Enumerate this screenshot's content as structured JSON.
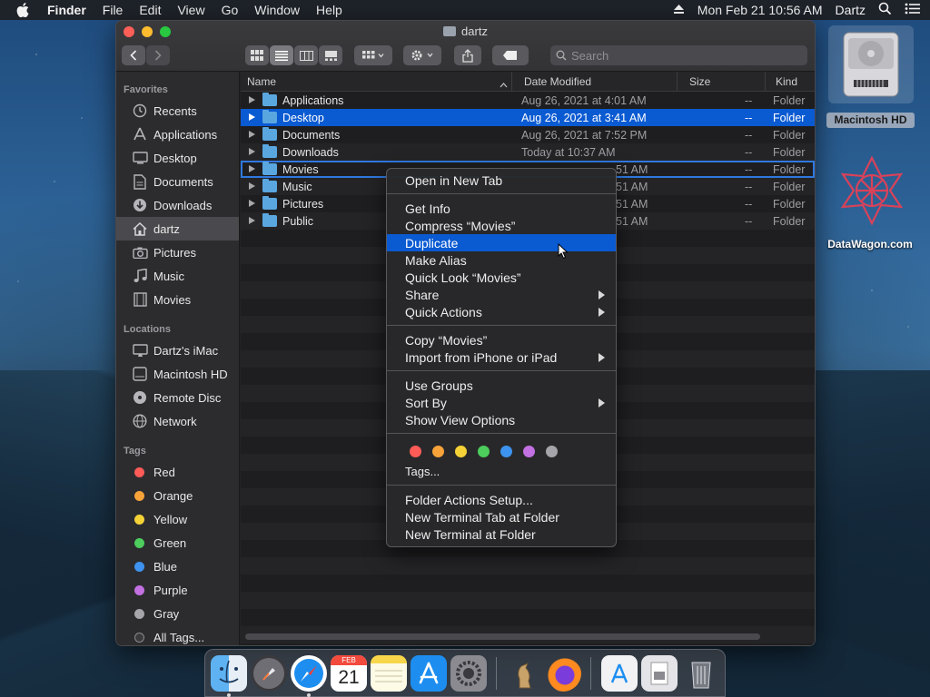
{
  "menubar": {
    "app": "Finder",
    "items": [
      "File",
      "Edit",
      "View",
      "Go",
      "Window",
      "Help"
    ],
    "datetime": "Mon Feb 21  10:56 AM",
    "user": "Dartz"
  },
  "window": {
    "title": "dartz",
    "search_placeholder": "Search"
  },
  "sidebar": {
    "favorites_header": "Favorites",
    "favorites": [
      {
        "label": "Recents",
        "icon": "clock-icon"
      },
      {
        "label": "Applications",
        "icon": "applications-icon"
      },
      {
        "label": "Desktop",
        "icon": "desktop-icon"
      },
      {
        "label": "Documents",
        "icon": "document-icon"
      },
      {
        "label": "Downloads",
        "icon": "download-icon"
      },
      {
        "label": "dartz",
        "icon": "home-icon"
      },
      {
        "label": "Pictures",
        "icon": "camera-icon"
      },
      {
        "label": "Music",
        "icon": "music-note-icon"
      },
      {
        "label": "Movies",
        "icon": "film-icon"
      }
    ],
    "locations_header": "Locations",
    "locations": [
      {
        "label": "Dartz's iMac",
        "icon": "imac-icon"
      },
      {
        "label": "Macintosh HD",
        "icon": "disk-icon"
      },
      {
        "label": "Remote Disc",
        "icon": "disc-icon"
      },
      {
        "label": "Network",
        "icon": "globe-icon"
      }
    ],
    "tags_header": "Tags",
    "tags": [
      {
        "label": "Red",
        "color": "#ff5b57"
      },
      {
        "label": "Orange",
        "color": "#f7a33a"
      },
      {
        "label": "Yellow",
        "color": "#f5d236"
      },
      {
        "label": "Green",
        "color": "#4ccd5c"
      },
      {
        "label": "Blue",
        "color": "#3d93ef"
      },
      {
        "label": "Purple",
        "color": "#c270e2"
      },
      {
        "label": "Gray",
        "color": "#a5a5aa"
      },
      {
        "label": "All Tags...",
        "color": ""
      }
    ]
  },
  "columns": {
    "name": "Name",
    "date": "Date Modified",
    "size": "Size",
    "kind": "Kind"
  },
  "files": [
    {
      "name": "Applications",
      "date": "Aug 26, 2021 at 4:01 AM",
      "size": "--",
      "kind": "Folder"
    },
    {
      "name": "Desktop",
      "date": "Aug 26, 2021 at 3:41 AM",
      "size": "--",
      "kind": "Folder"
    },
    {
      "name": "Documents",
      "date": "Aug 26, 2021 at 7:52 PM",
      "size": "--",
      "kind": "Folder"
    },
    {
      "name": "Downloads",
      "date": "Today at 10:37 AM",
      "size": "--",
      "kind": "Folder"
    },
    {
      "name": "Movies",
      "date": "51 AM",
      "size": "--",
      "kind": "Folder"
    },
    {
      "name": "Music",
      "date": "51 AM",
      "size": "--",
      "kind": "Folder"
    },
    {
      "name": "Pictures",
      "date": "51 AM",
      "size": "--",
      "kind": "Folder"
    },
    {
      "name": "Public",
      "date": "51 AM",
      "size": "--",
      "kind": "Folder"
    }
  ],
  "context_menu": {
    "open_new_tab": "Open in New Tab",
    "get_info": "Get Info",
    "compress": "Compress “Movies”",
    "duplicate": "Duplicate",
    "make_alias": "Make Alias",
    "quick_look": "Quick Look “Movies”",
    "share": "Share",
    "quick_actions": "Quick Actions",
    "copy": "Copy “Movies”",
    "import_iphone": "Import from iPhone or iPad",
    "use_groups": "Use Groups",
    "sort_by": "Sort By",
    "show_view_options": "Show View Options",
    "tag_colors": [
      "#ff5b57",
      "#f7a33a",
      "#f5d236",
      "#4ccd5c",
      "#3d93ef",
      "#c270e2",
      "#a5a5aa"
    ],
    "tags": "Tags...",
    "folder_actions": "Folder Actions Setup...",
    "new_terminal_tab": "New Terminal Tab at Folder",
    "new_terminal": "New Terminal at Folder"
  },
  "desktop": {
    "hd_label": "Macintosh HD",
    "datawagon_label": "DataWagon.com"
  },
  "dock": {
    "calendar_month": "FEB",
    "calendar_day": "21"
  }
}
